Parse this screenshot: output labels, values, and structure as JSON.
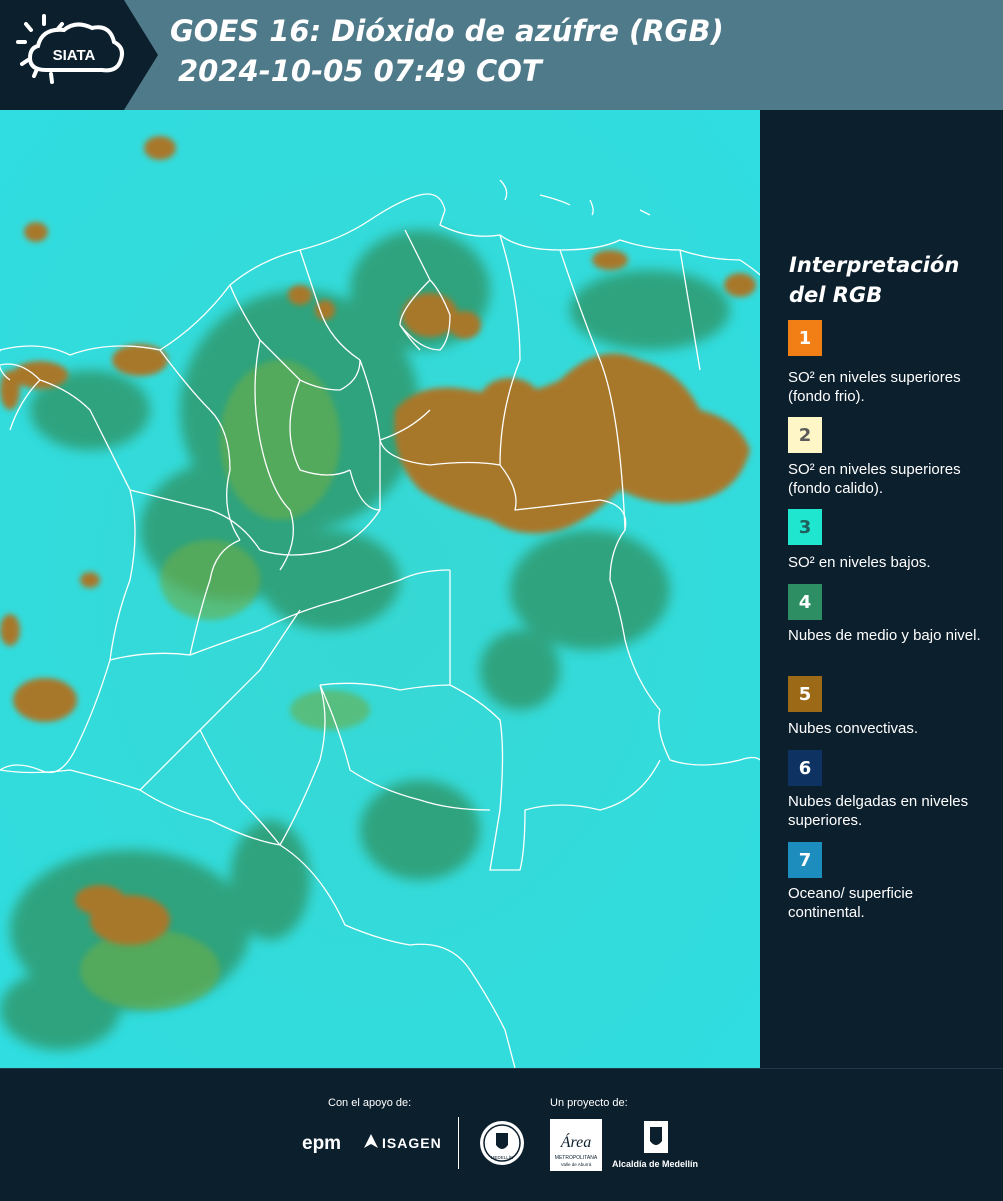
{
  "header": {
    "logo_text": "SIATA",
    "title_line1": "GOES 16: Dióxido de azúfre (RGB)",
    "title_line2": "2024-10-05 07:49 COT"
  },
  "map": {
    "description_icon": "satellite-rgb-map",
    "background_color": "#2fd9d9",
    "convective_cloud_color": "#a8782a",
    "low_cloud_color": "#2f8e5e",
    "border_color": "#ffffff"
  },
  "legend": {
    "title": "Interpretación del RGB",
    "items": [
      {
        "number": "1",
        "color": "#f27f16",
        "number_color": "#ffffff",
        "label": "SO² en niveles superiores (fondo frio)."
      },
      {
        "number": "2",
        "color": "#fff6c8",
        "number_color": "#5a5a5a",
        "label": "SO² en niveles superiores (fondo calido)."
      },
      {
        "number": "3",
        "color": "#1fe6cf",
        "number_color": "#1f5e5a",
        "label": "SO² en niveles bajos."
      },
      {
        "number": "4",
        "color": "#2e8e63",
        "number_color": "#ffffff",
        "label": "Nubes de medio y bajo nivel."
      },
      {
        "number": "5",
        "color": "#9c6a17",
        "number_color": "#ffffff",
        "label": "Nubes convectivas."
      },
      {
        "number": "6",
        "color": "#0e3363",
        "number_color": "#ffffff",
        "label": "Nubes delgadas en niveles superiores."
      },
      {
        "number": "7",
        "color": "#1c8dbd",
        "number_color": "#ffffff",
        "label": "Oceano/ superficie continental."
      }
    ]
  },
  "footer": {
    "support_label": "Con el apoyo de:",
    "project_label": "Un proyecto de:",
    "sponsors": [
      "epm",
      "ISAGEN"
    ],
    "area_logo_text": "Área",
    "area_logo_sub": "METROPOLITANA",
    "area_logo_sub2": "Valle de Aburrá",
    "seal_text": "MEDELLÍN",
    "alcaldia_label": "Alcaldía de Medellín"
  }
}
